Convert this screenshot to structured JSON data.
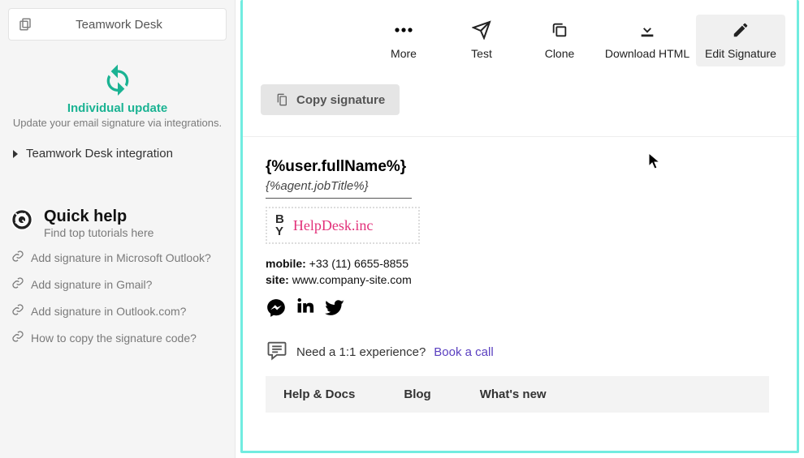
{
  "sidebar": {
    "app_name": "Teamwork Desk",
    "update_title": "Individual update",
    "update_subtitle": "Update your email signature via integrations.",
    "tree_item": "Teamwork Desk integration",
    "quick_help_title": "Quick help",
    "quick_help_subtitle": "Find top tutorials here",
    "help_links": [
      "Add signature in Microsoft Outlook?",
      "Add signature in Gmail?",
      "Add signature in Outlook.com?",
      "How to copy the signature code?"
    ]
  },
  "toolbar": {
    "more": "More",
    "test": "Test",
    "clone": "Clone",
    "download": "Download HTML",
    "edit": "Edit Signature"
  },
  "actions": {
    "copy_signature": "Copy signature"
  },
  "signature": {
    "full_name": "{%user.fullName%}",
    "job_title": "{%agent.jobTitle%}",
    "logo_by_top": "B",
    "logo_by_bottom": "Y",
    "logo_brand": "HelpDesk.inc",
    "mobile_label": "mobile:",
    "mobile_value": "+33 (11) 6655-8855",
    "site_label": "site:",
    "site_value": "www.company-site.com",
    "need_text": "Need a 1:1 experience?",
    "book_call": "Book a call"
  },
  "footer": {
    "help_docs": "Help & Docs",
    "blog": "Blog",
    "whats_new": "What's new"
  }
}
